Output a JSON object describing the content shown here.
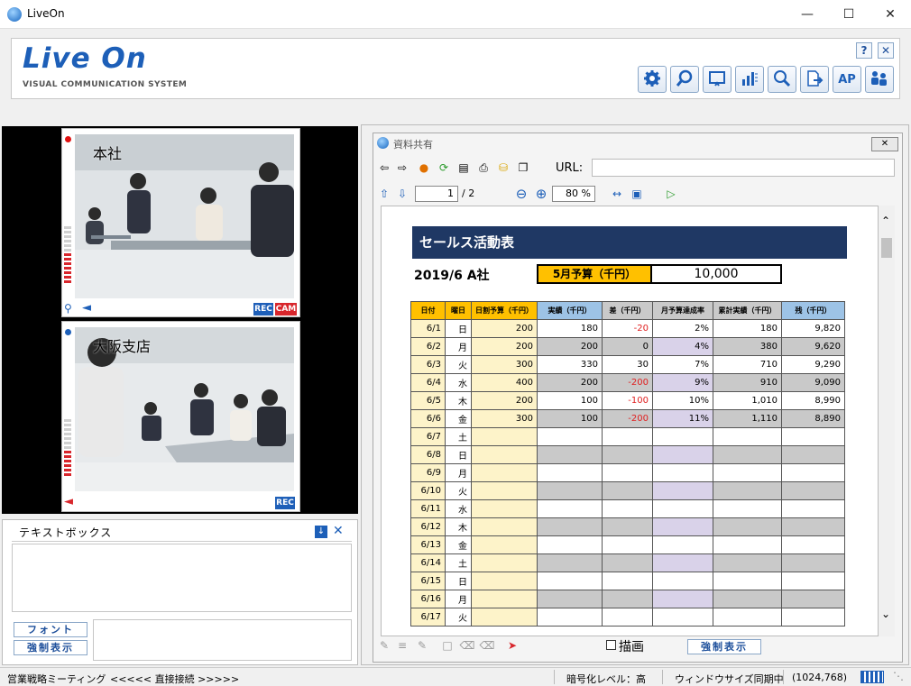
{
  "window": {
    "title": "LiveOn"
  },
  "header": {
    "logo": "Live On",
    "logo_sub": "VISUAL COMMUNICATION SYSTEM",
    "help": "?",
    "close": "✕",
    "ap_label": "AP"
  },
  "video": {
    "panels": [
      {
        "label": "本社",
        "rec": "REC",
        "cam": "CAM"
      },
      {
        "label": "大阪支店",
        "rec": "REC"
      }
    ]
  },
  "textbox": {
    "title": "テキストボックス",
    "font_button": "フォント",
    "force_button": "強制表示"
  },
  "document": {
    "title": "資料共有",
    "url_label": "URL:",
    "url_value": "",
    "page_current": "1",
    "page_total": "/ 2",
    "zoom": "80 %",
    "draw_label": "描画",
    "force_button": "強制表示",
    "sheet": {
      "title": "セールス活動表",
      "subtitle": "2019/6 A社",
      "budget_label": "5月予算（千円）",
      "budget_value": "10,000",
      "headers": [
        "日付",
        "曜日",
        "日割予算（千円）",
        "実績（千円）",
        "差（千円）",
        "月予算達成率",
        "累計実績（千円）",
        "残（千円）"
      ],
      "rows": [
        [
          "6/1",
          "日",
          "200",
          "180",
          "-20",
          "2%",
          "180",
          "9,820"
        ],
        [
          "6/2",
          "月",
          "200",
          "200",
          "0",
          "4%",
          "380",
          "9,620"
        ],
        [
          "6/3",
          "火",
          "300",
          "330",
          "30",
          "7%",
          "710",
          "9,290"
        ],
        [
          "6/4",
          "水",
          "400",
          "200",
          "-200",
          "9%",
          "910",
          "9,090"
        ],
        [
          "6/5",
          "木",
          "200",
          "100",
          "-100",
          "10%",
          "1,010",
          "8,990"
        ],
        [
          "6/6",
          "金",
          "300",
          "100",
          "-200",
          "11%",
          "1,110",
          "8,890"
        ],
        [
          "6/7",
          "土",
          "",
          "",
          "",
          "",
          "",
          ""
        ],
        [
          "6/8",
          "日",
          "",
          "",
          "",
          "",
          "",
          ""
        ],
        [
          "6/9",
          "月",
          "",
          "",
          "",
          "",
          "",
          ""
        ],
        [
          "6/10",
          "火",
          "",
          "",
          "",
          "",
          "",
          ""
        ],
        [
          "6/11",
          "水",
          "",
          "",
          "",
          "",
          "",
          ""
        ],
        [
          "6/12",
          "木",
          "",
          "",
          "",
          "",
          "",
          ""
        ],
        [
          "6/13",
          "金",
          "",
          "",
          "",
          "",
          "",
          ""
        ],
        [
          "6/14",
          "土",
          "",
          "",
          "",
          "",
          "",
          ""
        ],
        [
          "6/15",
          "日",
          "",
          "",
          "",
          "",
          "",
          ""
        ],
        [
          "6/16",
          "月",
          "",
          "",
          "",
          "",
          "",
          ""
        ],
        [
          "6/17",
          "火",
          "",
          "",
          "",
          "",
          "",
          ""
        ]
      ]
    }
  },
  "status": {
    "meeting": "営業戦略ミーティング",
    "connection": "<<<<< 直接接続 >>>>>",
    "encryption": "暗号化レベル：高",
    "sync": "ウィンドウサイズ同期中",
    "resolution": "(1024,768)"
  },
  "colors": {
    "brand": "#1d5fb8",
    "sheet_title_bg": "#1f3864",
    "budget_bg": "#ffc000",
    "negative": "#e02020",
    "rec_badge": "#1e5fb8",
    "cam_badge": "#d8262c"
  }
}
